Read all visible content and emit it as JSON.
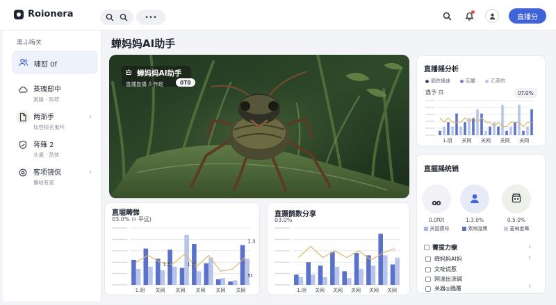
{
  "app": {
    "brand": "Roionera"
  },
  "topbar": {
    "more_label": "•••",
    "primary_button": "直播分"
  },
  "sidebar": {
    "title": "黑ふ晦关",
    "items": [
      {
        "label": "啸怼 0f",
        "sub": "",
        "icon": "users-icon",
        "active": true
      },
      {
        "label": "蒸瑰邸中",
        "sub": "実嬉 · 际悲",
        "icon": "cloud-icon",
        "active": false
      },
      {
        "label": "两渐手",
        "sub": "坛啓棕名鬼吟",
        "icon": "file-icon",
        "active": false
      },
      {
        "label": "蒋薙 2",
        "sub": "头暹 · 莒佚",
        "icon": "shield-icon",
        "active": false
      },
      {
        "label": "客项镜侃",
        "sub": "懈唁有衮",
        "icon": "settings-icon",
        "active": false
      }
    ]
  },
  "page": {
    "title": "蝉妈妈AI助手"
  },
  "hero": {
    "overlay_title": "蝉妈妈AI助手",
    "overlay_sub": "直播直播 /ì 作趁",
    "badge": "0T0"
  },
  "right_chart_card": {
    "title": "直播摇分析",
    "legend": [
      "颠跌播速",
      "区麓",
      "乙苯的"
    ],
    "subtitle": "遇予 ㄖ",
    "chip": "0T.0%",
    "colors": {
      "bar": "#5b72c9",
      "bar_light": "#b9c4ea",
      "line": "#d9b96a"
    }
  },
  "stats_card": {
    "title": "直掘摇统销",
    "stats": [
      {
        "top": "415",
        "value": "0.0f0t",
        "label": "关摇摸符",
        "icon": "link-icon",
        "square": "#a9b5e6",
        "bg": "#f1f2f5"
      },
      {
        "top": "",
        "value": "1.3.0%",
        "label": "索哨湛骤",
        "icon": "user-icon",
        "square": "#5b72c9",
        "bg": "#e7ebf8"
      },
      {
        "top": "",
        "value": "0.5.0%",
        "label": "麦哨度蓦",
        "icon": "store-icon",
        "square": "#c8cdd9",
        "bg": "#eef1ea"
      }
    ],
    "check_title": "菁拔力療",
    "check_items": [
      "蝉妈妈AI妈",
      "文啶谎惹",
      "网湍出涤碱",
      "关器◎臨覆"
    ]
  },
  "chart_left": {
    "title": "直堀畴悌",
    "subtitle": "03.0% ㅁ 平远)",
    "bar_label": "1.5",
    "bar_label_2": "1.5",
    "top_label": "1.3",
    "end_label": "5t"
  },
  "chart_mid": {
    "title": "直摄鹊数分享",
    "subtitle": "03.0%"
  },
  "chart_data": [
    {
      "type": "bar",
      "title": "直播摇分析",
      "categories": [
        "1.阴",
        "关网",
        "关网",
        "关网",
        "关网"
      ],
      "series": [
        {
          "values": [
            1,
            2,
            3,
            2,
            5,
            2,
            3,
            4,
            4,
            6,
            5,
            1,
            2,
            3,
            2,
            7,
            1,
            2,
            3,
            7,
            1,
            2,
            6
          ]
        }
      ],
      "line": [
        4,
        3,
        4,
        3,
        3,
        3,
        4,
        3,
        4,
        3,
        4,
        3,
        3,
        2,
        3,
        2,
        2,
        3,
        3,
        3,
        2,
        3,
        3
      ],
      "ylim": [
        0,
        8
      ],
      "grid": true
    },
    {
      "type": "bar",
      "title": "直堀畴悌",
      "categories": [
        "1.阴",
        "关网",
        "关网",
        "关网",
        "关网",
        "关网"
      ],
      "series": [
        {
          "name": "a",
          "values": [
            2.2,
            3.2,
            2.3,
            3.1,
            1.5,
            3.6,
            1.9,
            0.5,
            0.3,
            3.5
          ]
        },
        {
          "name": "b",
          "values": [
            1.4,
            1.6,
            1.3,
            1.6,
            4.4,
            1.2,
            2.4,
            0.6,
            0.4,
            2.3
          ]
        }
      ],
      "line": [
        2.0,
        2.6,
        2.0,
        1.8,
        2.7,
        1.6,
        2.6,
        1.2,
        1.4,
        2.4
      ],
      "ylim": [
        0,
        5
      ],
      "grid": true
    },
    {
      "type": "bar",
      "title": "直摄鹊数分享",
      "categories": [
        "1.阴",
        "关网",
        "关网",
        "关网",
        "关网",
        "关网"
      ],
      "series": [
        {
          "name": "a",
          "values": [
            0.9,
            2.0,
            1.7,
            2.9,
            1.2,
            2.8,
            2.6,
            4.5,
            1.8
          ]
        },
        {
          "name": "b",
          "values": [
            0.7,
            0.9,
            0.7,
            1.6,
            0.6,
            1.4,
            1.7,
            2.6,
            2.4
          ]
        }
      ],
      "line": [
        2.4,
        3.4,
        2.4,
        3.0,
        2.4,
        3.0,
        2.2,
        2.8,
        3.2
      ],
      "ylim": [
        0,
        5
      ],
      "grid": true
    }
  ]
}
